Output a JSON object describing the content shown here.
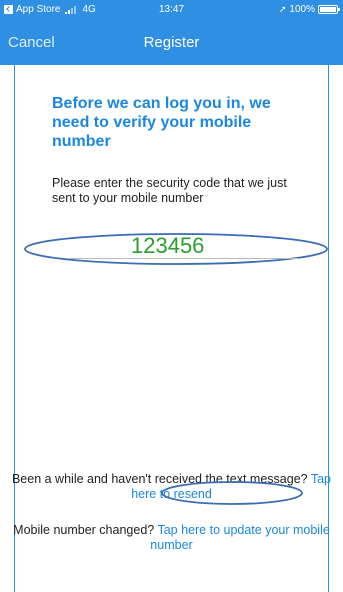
{
  "status_bar": {
    "back_app": "App Store",
    "network": "4G",
    "time": "13:47",
    "battery": "100%",
    "icons": [
      "back-arrow-icon",
      "signal-icon",
      "location-icon",
      "battery-icon"
    ]
  },
  "nav": {
    "cancel_label": "Cancel",
    "title": "Register"
  },
  "heading": "Before we can log you in, we need to verify your mobile number",
  "instruction": "Please enter the security code that we just sent to your mobile number",
  "code_input": {
    "value": "123456",
    "placeholder": ""
  },
  "resend": {
    "prefix": "Been a while and haven't received the text message?",
    "link_label": "Tap here to resend"
  },
  "changed": {
    "prefix": "Mobile number changed?",
    "link_label": "Tap here to update your mobile number"
  },
  "colors": {
    "accent": "#2f8fe3",
    "link": "#1b87e0",
    "code_text": "#2aa02a",
    "annotation": "#3a6db3"
  }
}
